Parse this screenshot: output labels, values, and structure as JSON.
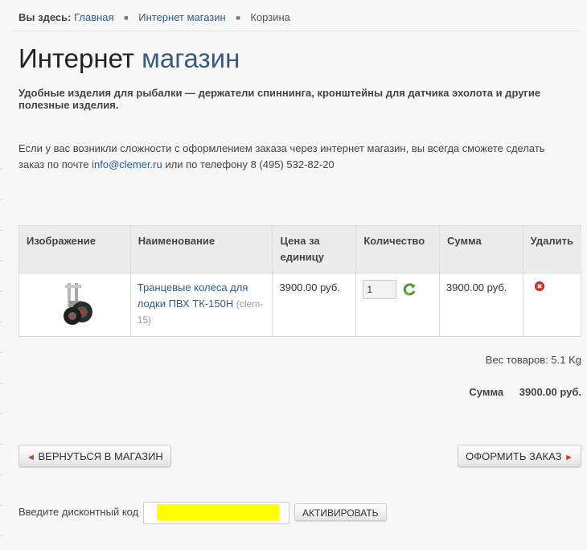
{
  "breadcrumb": {
    "prefix": "Вы здесь:",
    "items": [
      "Главная",
      "Интернет магазин",
      "Корзина"
    ]
  },
  "heading": {
    "part1": "Интернет",
    "part2": "магазин"
  },
  "subtitle": "Удобные изделия для рыбалки — держатели спиннинга, кронштейны для датчика эхолота и другие полезные изделия.",
  "info": {
    "before": "Если у вас возникли сложности с оформлением заказа через интернет магазин, вы всегда сможете сделать заказ по почте ",
    "email": "info@clemer.ru",
    "after": " или по телефону 8 (495) 532-82-20"
  },
  "cart": {
    "headers": [
      "Изображение",
      "Наименование",
      "Цена за единицу",
      "Количество",
      "Сумма",
      "Удалить"
    ],
    "items": [
      {
        "image_icon": "boat-wheels-product-photo",
        "name": "Транцевые колеса для лодки ПВХ ТК-150Н",
        "sku": "(clem-15)",
        "price": "3900.00 руб.",
        "quantity": "1",
        "sum": "3900.00 руб.",
        "update_icon": "refresh-icon",
        "delete_icon": "remove-icon"
      }
    ]
  },
  "weight": "Вес товаров: 5.1 Kg",
  "total": {
    "label": "Сумма",
    "value": "3900.00 руб."
  },
  "buttons": {
    "back": "ВЕРНУТЬСЯ В МАГАЗИН",
    "checkout": "ОФОРМИТЬ ЗАКАЗ",
    "activate": "АКТИВИРОВАТЬ"
  },
  "discount": {
    "label": "Введите дисконтный код",
    "value": ""
  },
  "colors": {
    "link": "#2d5d8f",
    "arrow": "#c0392b",
    "highlight": "#ffff00"
  }
}
